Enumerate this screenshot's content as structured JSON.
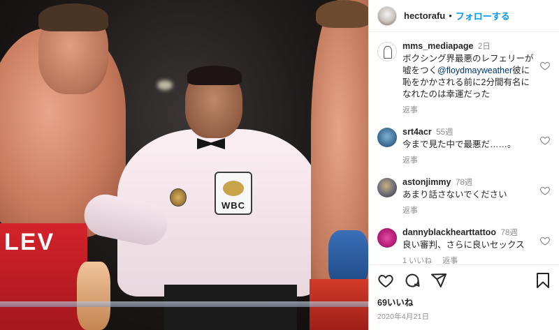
{
  "photo": {
    "trunks_text": "LEV",
    "badge_text": "WBC"
  },
  "post": {
    "owner": "hectorafu",
    "separator": "•",
    "follow_label": "フォローする"
  },
  "comments": [
    {
      "username": "mms_mediapage",
      "time": "2日",
      "text_parts": [
        "ボクシング界最悪のレフェリーが嘘をつく",
        "@floydmayweather",
        "彼に恥をかかされる前に2分間有名になれたのは幸運だった"
      ],
      "reply_label": "返事",
      "likes_label": ""
    },
    {
      "username": "srt4acr",
      "time": "55週",
      "text": "今まで見た中で最悪だ……。",
      "reply_label": "返事"
    },
    {
      "username": "astonjimmy",
      "time": "78週",
      "text": "あまり話さないでください",
      "reply_label": "返事"
    },
    {
      "username": "dannyblackhearttattoo",
      "time": "78週",
      "text": "良い審判、さらに良いセックス",
      "likes_label": "1 いいね",
      "reply_label": "返事"
    }
  ],
  "footer": {
    "likes": "69いいね",
    "date": "2020年4月21日"
  },
  "icons": {
    "heart": "heart-icon",
    "comment": "comment-icon",
    "share": "share-icon",
    "save": "bookmark-icon"
  }
}
